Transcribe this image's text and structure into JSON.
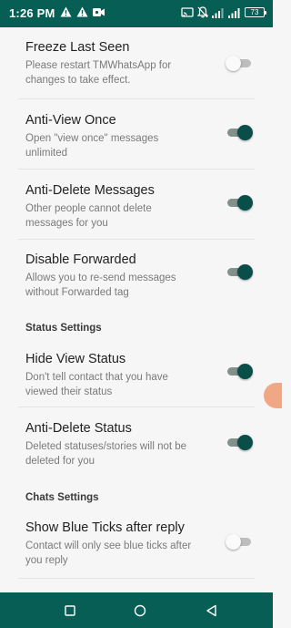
{
  "status_bar": {
    "time": "1:26 PM",
    "battery": "73",
    "left_icons": [
      "alert-icon",
      "alert-icon",
      "video-icon"
    ],
    "right_icons": [
      "cast-icon",
      "mute-icon",
      "signal-icon",
      "signal-icon",
      "battery-icon"
    ]
  },
  "colors": {
    "bar": "#075e54",
    "switch_on": "#0a4e4a",
    "switch_off": "#bdbdbd"
  },
  "settings": [
    {
      "title": "Freeze Last Seen",
      "summary": "Please restart TMWhatsApp for changes to take effect.",
      "enabled": false
    },
    {
      "title": "Anti-View Once",
      "summary": "Open \"view once\" messages unlimited",
      "enabled": true
    },
    {
      "title": "Anti-Delete Messages",
      "summary": "Other people cannot delete messages for you",
      "enabled": true
    },
    {
      "title": "Disable Forwarded",
      "summary": "Allows you to re-send messages without Forwarded tag",
      "enabled": true
    }
  ],
  "status_section": {
    "header": "Status Settings",
    "items": [
      {
        "title": "Hide View Status",
        "summary": "Don't tell contact that you have viewed their status",
        "enabled": true
      },
      {
        "title": "Anti-Delete Status",
        "summary": "Deleted statuses/stories will not be deleted for you",
        "enabled": true
      }
    ]
  },
  "chats_section": {
    "header": "Chats Settings",
    "items": [
      {
        "title": "Show Blue Ticks after reply",
        "summary": "Contact will only see blue ticks after you reply",
        "enabled": false
      }
    ]
  },
  "nav": {
    "buttons": [
      "recents-button",
      "home-button",
      "back-button"
    ]
  }
}
